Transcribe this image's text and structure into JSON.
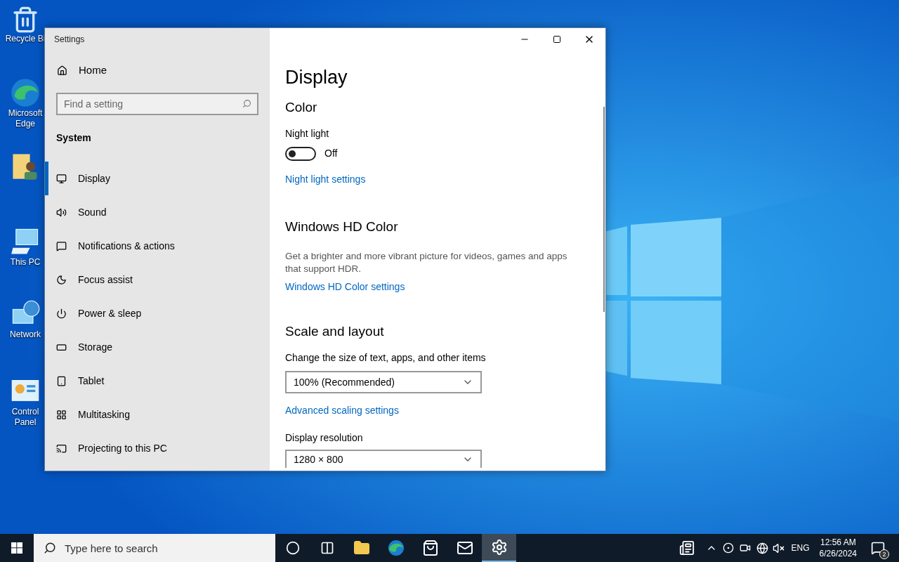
{
  "desktop_icons": [
    {
      "kind": "bin",
      "label": "Recycle Bi"
    },
    {
      "kind": "edge",
      "label": "Microsoft Edge"
    },
    {
      "kind": "folder"
    },
    {
      "kind": "pc",
      "label": "This PC"
    },
    {
      "kind": "network",
      "label": "Network"
    },
    {
      "kind": "control",
      "label": "Control Panel"
    }
  ],
  "window": {
    "title": "Settings"
  },
  "sidebar": {
    "home": "Home",
    "search": {
      "placeholder": "Find a setting"
    },
    "section": "System",
    "items": [
      {
        "kind": "display",
        "label": "Display",
        "selected": true
      },
      {
        "kind": "sound",
        "label": "Sound",
        "selected": false
      },
      {
        "kind": "notifications",
        "label": "Notifications & actions",
        "selected": false
      },
      {
        "kind": "focus",
        "label": "Focus assist",
        "selected": false
      },
      {
        "kind": "power",
        "label": "Power & sleep",
        "selected": false
      },
      {
        "kind": "storage",
        "label": "Storage",
        "selected": false
      },
      {
        "kind": "tablet",
        "label": "Tablet",
        "selected": false
      },
      {
        "kind": "multitasking",
        "label": "Multitasking",
        "selected": false
      },
      {
        "kind": "projecting",
        "label": "Projecting to this PC",
        "selected": false
      }
    ]
  },
  "content": {
    "title": "Display",
    "color": {
      "heading": "Color",
      "night_light": {
        "label": "Night light",
        "on": false,
        "state_text": "Off"
      },
      "link": "Night light settings"
    },
    "hd_color": {
      "heading": "Windows HD Color",
      "description": "Get a brighter and more vibrant picture for videos, games and apps that support HDR.",
      "link": "Windows HD Color settings"
    },
    "scale": {
      "heading": "Scale and layout",
      "size_label": "Change the size of text, apps, and other items",
      "size_value": "100% (Recommended)",
      "link": "Advanced scaling settings",
      "resolution_label": "Display resolution",
      "resolution_value": "1280 × 800"
    }
  },
  "taskbar": {
    "search": {
      "placeholder": "Type here to search"
    },
    "apps": [
      {
        "kind": "cortana",
        "selected": false
      },
      {
        "kind": "taskview",
        "selected": false
      },
      {
        "kind": "explorer",
        "selected": false
      },
      {
        "kind": "edge",
        "selected": false
      },
      {
        "kind": "store",
        "selected": false
      },
      {
        "kind": "mail",
        "selected": false
      },
      {
        "kind": "settings",
        "selected": true
      }
    ],
    "language": "ENG",
    "time": "12:56 AM",
    "date": "6/26/2024",
    "notification_count": "2"
  }
}
